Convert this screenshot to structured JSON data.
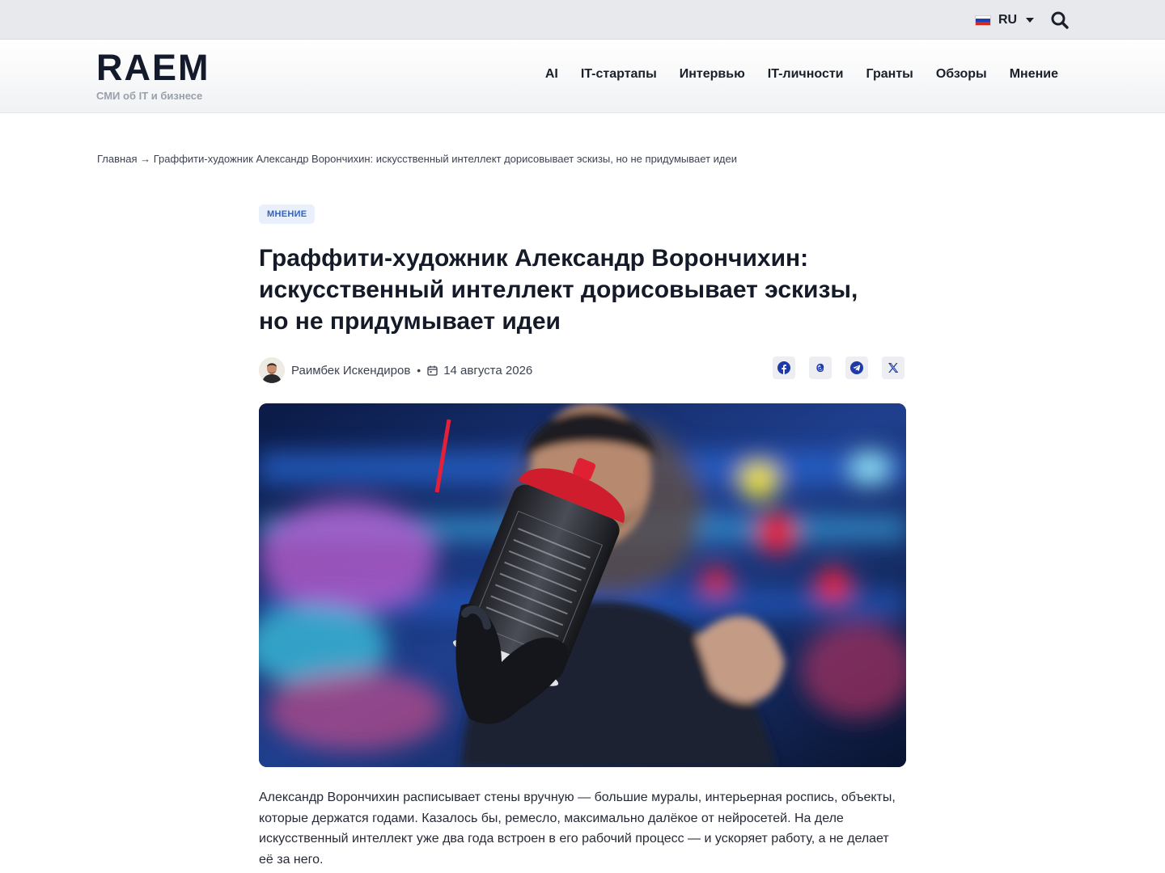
{
  "topbar": {
    "language": "RU",
    "flag_colors": [
      "#ffffff",
      "#1c3fb8",
      "#d52b1e"
    ],
    "search_icon": "search-icon"
  },
  "header": {
    "logo": "RAEM",
    "tagline": "СМИ об IT и бизнесе",
    "nav": [
      "AI",
      "IT-стартапы",
      "Интервью",
      "IT-личности",
      "Гранты",
      "Обзоры",
      "Мнение"
    ]
  },
  "breadcrumb": {
    "home": "Главная",
    "separator": "→",
    "current": "Граффити-художник Александр Ворончихин: искусственный интеллект дорисовывает эскизы, но не придумывает идеи"
  },
  "article": {
    "category": "МНЕНИЕ",
    "title_lines": [
      "Граффити-художник Александр Ворончихин:",
      "искусственный интеллект дорисовывает эскизы,",
      "но не придумывает идеи"
    ],
    "author": "Раимбек Искендиров",
    "separator": "•",
    "date": "14 августа 2026",
    "share": [
      "facebook-icon",
      "threads-icon",
      "telegram-icon",
      "x-icon"
    ],
    "lead": "Александр Ворончихин расписывает стены вручную — большие муралы, интерьерная роспись, объекты, которые держатся годами. Казалось бы, ремесло, максимально далёкое от нейросетей. На деле искусственный интеллект уже два года встроен в его рабочий процесс — и ускоряет работу, а не делает её за него."
  },
  "colors": {
    "accent": "#2f63c9",
    "badge_bg": "#e9effb",
    "text": "#141a28",
    "topbar_bg": "#e8e9ec"
  }
}
